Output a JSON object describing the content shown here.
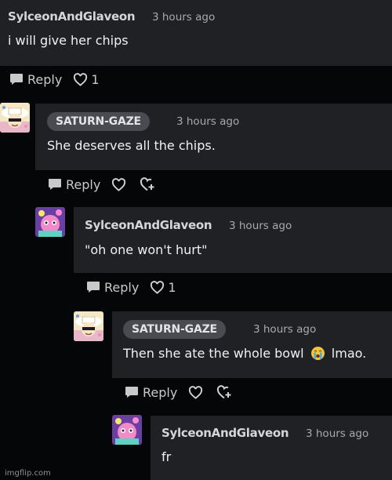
{
  "comments": [
    {
      "author": "SylceonAndGlaveon",
      "time": "3 hours ago",
      "text": "i will give her chips",
      "reply_label": "Reply",
      "likes": "1"
    },
    {
      "author": "SATURN-GAZE",
      "time": "3 hours ago",
      "text": "She deserves all the chips.",
      "reply_label": "Reply",
      "likes": ""
    },
    {
      "author": "SylceonAndGlaveon",
      "time": "3 hours ago",
      "text": "\"oh one won't hurt\"",
      "reply_label": "Reply",
      "likes": "1"
    },
    {
      "author": "SATURN-GAZE",
      "time": "3 hours ago",
      "text_before": "Then she ate the whole bowl",
      "emoji": "loudly-crying-face",
      "text_after": "lmao.",
      "reply_label": "Reply",
      "likes": ""
    },
    {
      "author": "SylceonAndGlaveon",
      "time": "3 hours ago",
      "text": "fr"
    }
  ],
  "watermark": "imgflip.com",
  "colors": {
    "background": "#050608",
    "panel": "#202125",
    "op_pill": "#4a4b50",
    "muted": "#a9a9ad"
  }
}
